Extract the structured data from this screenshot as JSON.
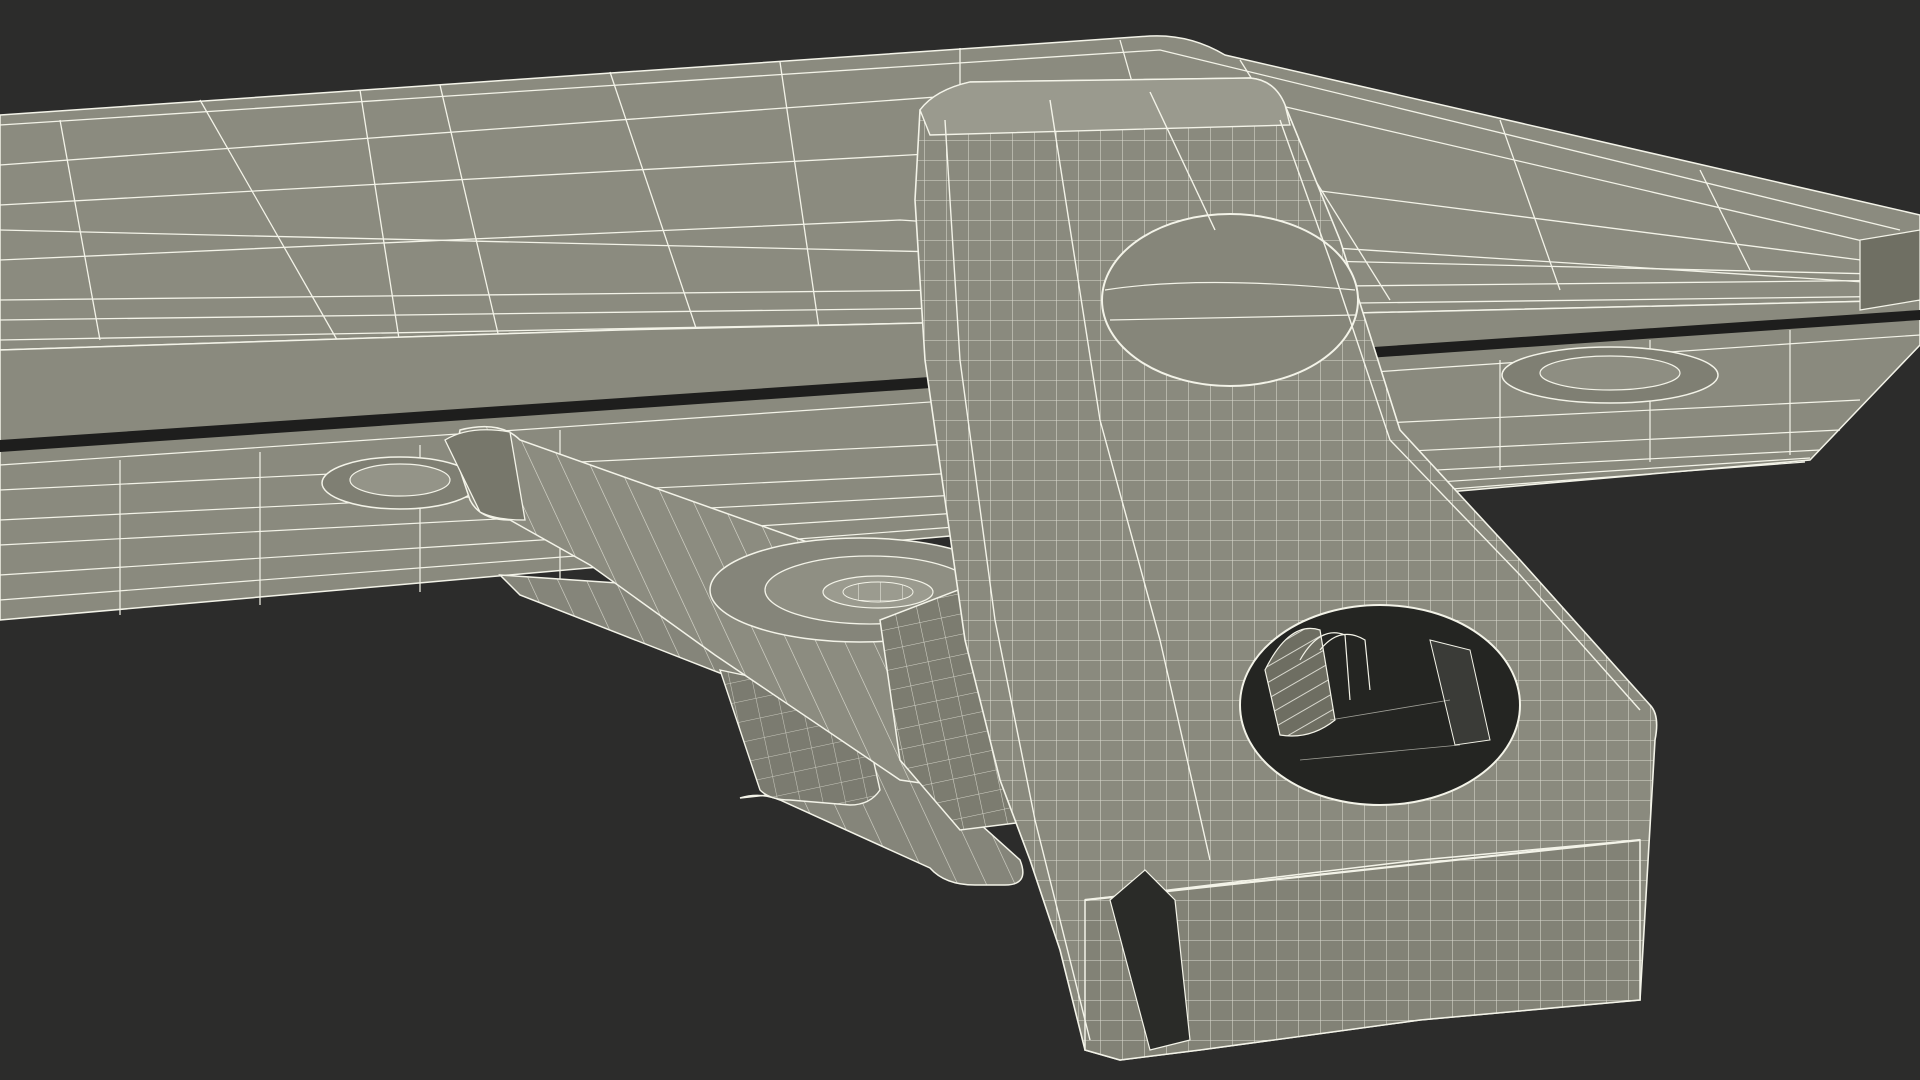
{
  "scene": {
    "subject": "clipboard-clip-wireframe-render",
    "colors": {
      "background": "#2c2c2b",
      "surface": "#87877a",
      "surface_light": "#94948a",
      "surface_dark": "#6f6f63",
      "shadow_edge": "#1e1e1d",
      "wire": "#f3f3e8",
      "hole_interior": "#242522"
    }
  }
}
